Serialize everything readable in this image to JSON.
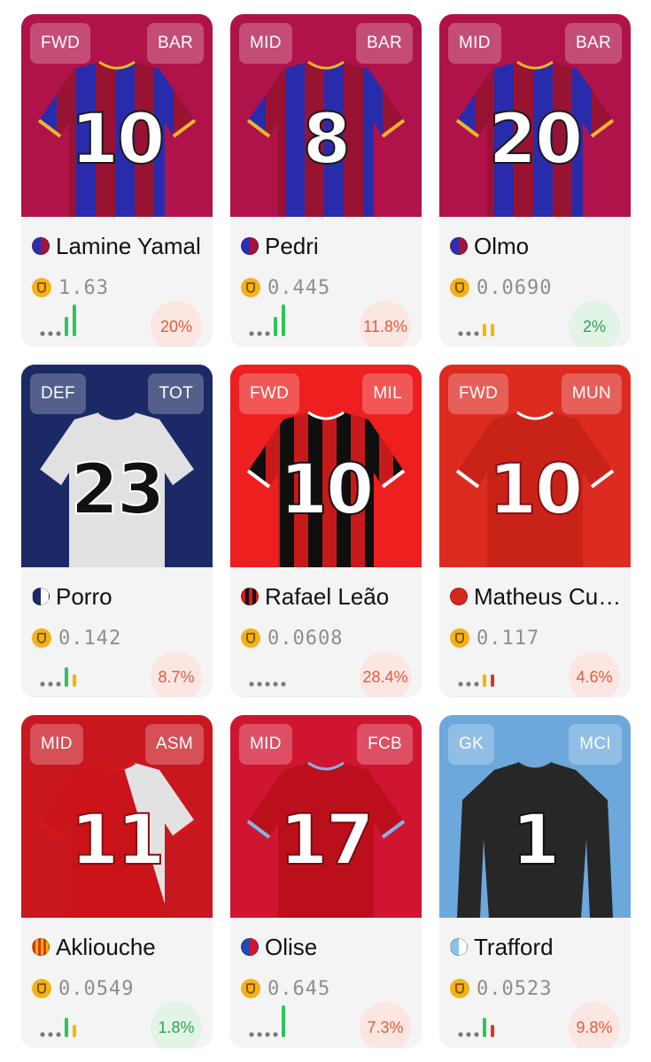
{
  "cards": [
    {
      "position": "FWD",
      "team": "BAR",
      "name": "Lamine Yamal",
      "price": "1.63",
      "change": "20%",
      "change_type": "neg",
      "number": "10",
      "bg": "#b0124a",
      "shirt": "barca",
      "club_icon": "barcelona-crest-icon",
      "bars": [
        "dot",
        "dot",
        "dot",
        "green",
        "green"
      ]
    },
    {
      "position": "MID",
      "team": "BAR",
      "name": "Pedri",
      "price": "0.445",
      "change": "11.8%",
      "change_type": "neg",
      "number": "8",
      "bg": "#b0124a",
      "shirt": "barca",
      "club_icon": "barcelona-crest-icon",
      "bars": [
        "dot",
        "dot",
        "dot",
        "green",
        "green"
      ]
    },
    {
      "position": "MID",
      "team": "BAR",
      "name": "Olmo",
      "price": "0.0690",
      "change": "2%",
      "change_type": "pos",
      "number": "20",
      "bg": "#b0124a",
      "shirt": "barca",
      "club_icon": "barcelona-crest-icon",
      "bars": [
        "dot",
        "dot",
        "dot",
        "yellow",
        "yellow"
      ]
    },
    {
      "position": "DEF",
      "team": "TOT",
      "name": "Porro",
      "price": "0.142",
      "change": "8.7%",
      "change_type": "neg",
      "number": "23",
      "bg": "#1b2a66",
      "shirt": "spurs",
      "club_icon": "tottenham-crest-icon",
      "bars": [
        "dot",
        "dot",
        "dot",
        "green",
        "yellow"
      ]
    },
    {
      "position": "FWD",
      "team": "MIL",
      "name": "Rafael Leão",
      "price": "0.0608",
      "change": "28.4%",
      "change_type": "neg",
      "number": "10",
      "bg": "#ee1f1f",
      "shirt": "milan",
      "club_icon": "ac-milan-crest-icon",
      "bars": [
        "dot",
        "dot",
        "dot",
        "dot",
        "dot"
      ]
    },
    {
      "position": "FWD",
      "team": "MUN",
      "name": "Matheus Cunha",
      "price": "0.117",
      "change": "4.6%",
      "change_type": "neg",
      "number": "10",
      "bg": "#dd2b20",
      "shirt": "united",
      "club_icon": "man-united-crest-icon",
      "bars": [
        "dot",
        "dot",
        "dot",
        "yellow",
        "red"
      ]
    },
    {
      "position": "MID",
      "team": "ASM",
      "name": "Akliouche",
      "price": "0.0549",
      "change": "1.8%",
      "change_type": "pos",
      "number": "11",
      "bg": "#c8171f",
      "shirt": "monaco",
      "club_icon": "monaco-crest-icon",
      "bars": [
        "dot",
        "dot",
        "dot",
        "green",
        "yellow"
      ]
    },
    {
      "position": "MID",
      "team": "FCB",
      "name": "Olise",
      "price": "0.645",
      "change": "7.3%",
      "change_type": "neg",
      "number": "17",
      "bg": "#d01532",
      "shirt": "bayern",
      "club_icon": "bayern-crest-icon",
      "bars": [
        "dot",
        "dot",
        "dot",
        "dot",
        "green"
      ]
    },
    {
      "position": "GK",
      "team": "MCI",
      "name": "Trafford",
      "price": "0.0523",
      "change": "9.8%",
      "change_type": "neg",
      "number": "1",
      "bg": "#6ca8dc",
      "shirt": "city",
      "club_icon": "man-city-crest-icon",
      "bars": [
        "dot",
        "dot",
        "dot",
        "green",
        "red"
      ]
    }
  ],
  "colors": {
    "green": "#2fc35a",
    "yellow": "#f5b400",
    "red": "#e2341d",
    "dot": "#7a7a7a"
  }
}
